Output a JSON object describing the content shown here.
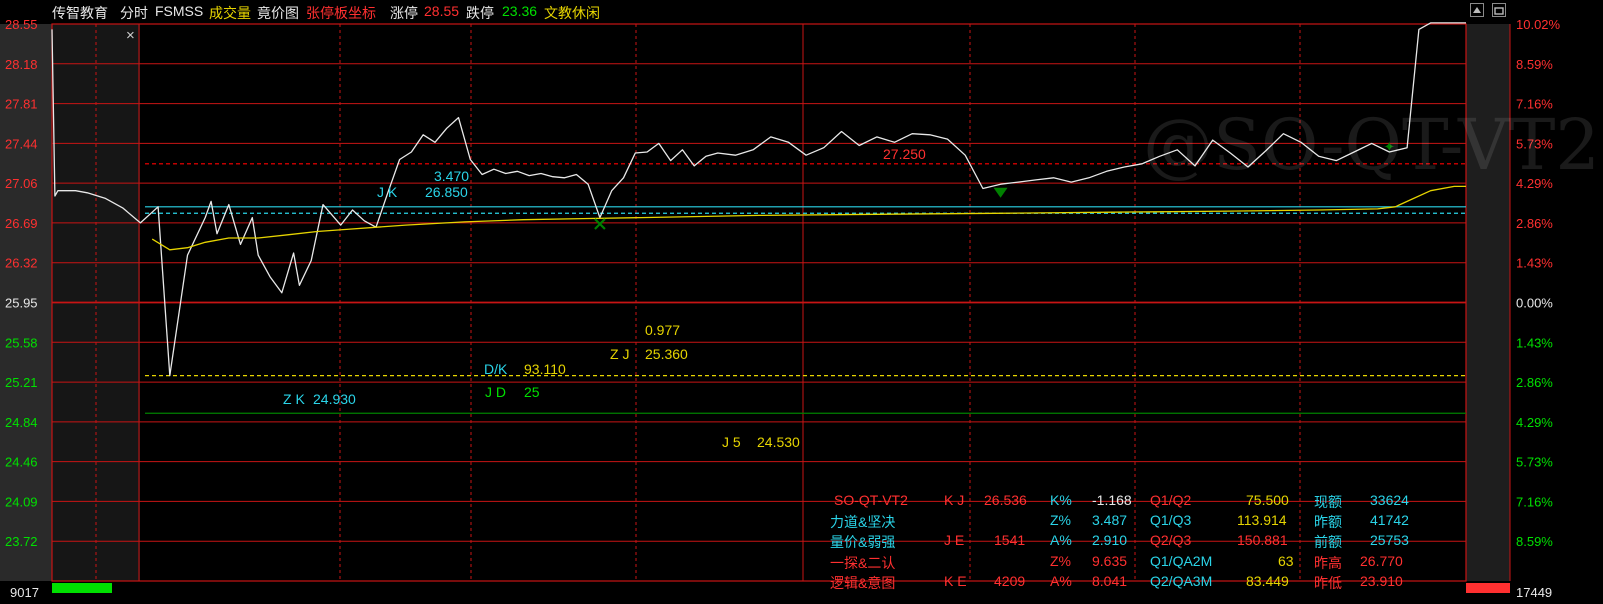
{
  "header": {
    "stock_name": "传智教育",
    "mode": "分时",
    "indicator": "FSMSS",
    "volume": "成交量",
    "auction": "竟价图",
    "limit_coord": "张停板坐标",
    "limit_up_label": "涨停",
    "limit_up_value": "28.55",
    "limit_down_label": "跌停",
    "limit_down_value": "23.36",
    "sector": "文教休闲"
  },
  "watermark": "@SO-QT-VT2",
  "close_mark": "×",
  "annotations": {
    "jk_label": "J K",
    "jk_value": "26.850",
    "upper_value": "3.470",
    "line_value": "27.250",
    "val_0977": "0.977",
    "zj_label": "Z J",
    "zj_value": "25.360",
    "dk_label": "D/K",
    "dk_value": "93.110",
    "jd_label": "J D",
    "jd_value": "25",
    "zk_label": "Z K",
    "zk_value": "24.930",
    "j5_label": "J 5",
    "j5_value": "24.530"
  },
  "colors": {
    "background": "#000000",
    "grid": "#c81414",
    "price_line": "#e8e8e8",
    "avg_line": "#e6d400",
    "up": "#ff3030",
    "down": "#00e000",
    "cyan": "#2ad4e8",
    "yellow": "#e6d400"
  },
  "info_table": {
    "rows": [
      [
        "SO-QT-VT2",
        "K J",
        "26.536",
        "K%",
        "-1.168",
        "Q1/Q2",
        "75.500",
        "现额",
        "33624"
      ],
      [
        "力道&坚决",
        "",
        "",
        "Z%",
        "3.487",
        "Q1/Q3",
        "113.914",
        "昨额",
        "41742"
      ],
      [
        "量价&弱强",
        "J E",
        "1541",
        "A%",
        "2.910",
        "Q2/Q3",
        "150.881",
        "前额",
        "25753"
      ],
      [
        "一探&二认",
        "",
        "",
        "Z%",
        "9.635",
        "Q1/QA2M",
        "63",
        "昨高",
        "26.770"
      ],
      [
        "逻辑&意图",
        "K E",
        "4209",
        "A%",
        "8.041",
        "Q2/QA3M",
        "83.449",
        "昨低",
        "23.910"
      ]
    ]
  },
  "chart_data": {
    "type": "line",
    "title": "",
    "xlabel": "",
    "ylabel": "",
    "prev_close": 25.95,
    "ylim": [
      23.36,
      28.55
    ],
    "y_ticks_left": [
      "28.55",
      "28.18",
      "27.81",
      "27.44",
      "27.06",
      "26.69",
      "26.32",
      "25.95",
      "25.58",
      "25.21",
      "24.84",
      "24.46",
      "24.09",
      "23.72"
    ],
    "y_ticks_right": [
      "10.02%",
      "8.59%",
      "7.16%",
      "5.73%",
      "4.29%",
      "2.86%",
      "1.43%",
      "0.00%",
      "1.43%",
      "2.86%",
      "4.29%",
      "5.73%",
      "7.16%",
      "8.59%"
    ],
    "volume_left_label": "9017",
    "volume_right_label": "17449",
    "x_range": [
      0,
      240
    ],
    "series": [
      {
        "role": "price",
        "x": [
          0,
          0.5,
          1,
          4,
          6,
          9,
          12,
          15,
          18,
          20,
          23,
          26,
          27,
          28,
          30,
          32,
          34,
          35,
          37,
          39,
          41,
          42,
          44,
          46,
          49,
          51,
          53,
          55,
          57,
          59,
          61,
          63,
          65,
          67,
          69,
          71,
          73,
          75,
          77,
          79,
          81,
          83,
          85,
          87,
          89,
          91,
          93,
          95,
          97,
          99,
          101,
          103,
          105,
          107,
          109,
          111,
          113,
          116,
          119,
          122,
          125,
          128,
          131,
          134,
          137,
          140,
          143,
          146,
          149,
          152,
          155,
          158,
          161,
          164,
          167,
          170,
          173,
          176,
          179,
          182,
          185,
          188,
          191,
          194,
          197,
          200,
          203,
          206,
          209,
          212,
          215,
          218,
          221,
          224,
          227,
          230,
          232,
          234,
          236,
          238,
          240
        ],
        "values": [
          28.5,
          26.95,
          27.0,
          27.0,
          26.98,
          26.93,
          26.84,
          26.7,
          26.85,
          25.28,
          26.4,
          26.75,
          26.9,
          26.6,
          26.87,
          26.5,
          26.75,
          26.4,
          26.2,
          26.05,
          26.42,
          26.12,
          26.35,
          26.87,
          26.68,
          26.82,
          26.72,
          26.66,
          26.98,
          27.29,
          27.36,
          27.52,
          27.45,
          27.58,
          27.68,
          27.29,
          27.15,
          27.2,
          27.16,
          27.18,
          27.14,
          27.16,
          27.13,
          27.12,
          27.15,
          27.06,
          26.75,
          27.0,
          27.12,
          27.35,
          27.36,
          27.44,
          27.28,
          27.38,
          27.23,
          27.32,
          27.35,
          27.33,
          27.38,
          27.5,
          27.45,
          27.33,
          27.4,
          27.55,
          27.42,
          27.5,
          27.45,
          27.53,
          27.52,
          27.48,
          27.33,
          27.02,
          27.06,
          27.08,
          27.1,
          27.12,
          27.08,
          27.12,
          27.18,
          27.22,
          27.25,
          27.32,
          27.38,
          27.23,
          27.47,
          27.35,
          27.22,
          27.37,
          27.53,
          27.45,
          27.32,
          27.28,
          27.36,
          27.44,
          27.36,
          27.4,
          28.5,
          28.56,
          28.56,
          28.56,
          28.56
        ]
      },
      {
        "role": "avg",
        "x": [
          17,
          20,
          23,
          26,
          30,
          35,
          40,
          45,
          50,
          60,
          70,
          80,
          90,
          100,
          120,
          140,
          160,
          180,
          200,
          215,
          225,
          228,
          230,
          234,
          238,
          240
        ],
        "values": [
          26.55,
          26.45,
          26.47,
          26.52,
          26.56,
          26.56,
          26.59,
          26.62,
          26.64,
          26.68,
          26.71,
          26.73,
          26.74,
          26.75,
          26.77,
          26.78,
          26.79,
          26.8,
          26.81,
          26.82,
          26.83,
          26.85,
          26.9,
          27.0,
          27.04,
          27.04
        ]
      }
    ],
    "horizontal_lines": [
      {
        "value": 26.85,
        "style": "solid",
        "color": "cyan"
      },
      {
        "value": 26.79,
        "style": "dashed",
        "color": "cyan"
      },
      {
        "value": 27.25,
        "style": "dashed",
        "color": "red"
      },
      {
        "value": 25.28,
        "style": "dashed",
        "color": "yellow"
      },
      {
        "value": 24.93,
        "style": "solid",
        "color": "green"
      }
    ],
    "markers": [
      {
        "type": "x",
        "x": 93,
        "value": 26.69,
        "color": "green"
      },
      {
        "type": "triangle-down",
        "x": 161,
        "value": 26.99,
        "color": "green"
      },
      {
        "type": "star",
        "x": 227,
        "value": 27.41,
        "color": "green"
      }
    ]
  }
}
